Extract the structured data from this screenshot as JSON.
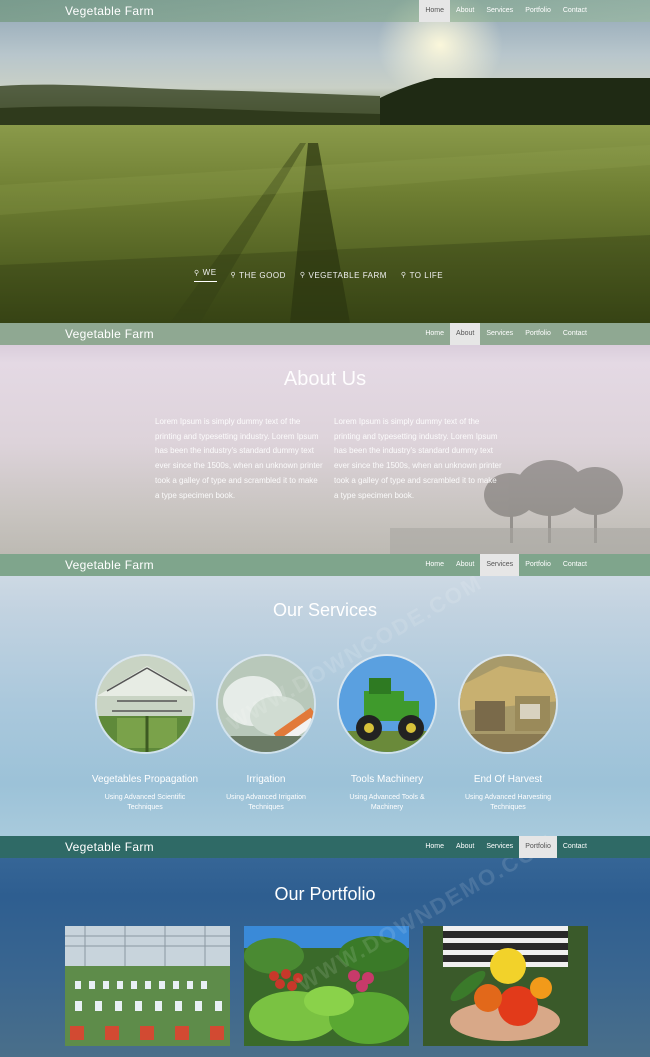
{
  "brand": "Vegetable Farm",
  "nav_items": [
    "Home",
    "About",
    "Services",
    "Portfolio",
    "Contact"
  ],
  "hero": {
    "tabs": [
      "WE",
      "THE GOOD",
      "VEGETABLE FARM",
      "TO LIFE"
    ],
    "active_tab": "WE"
  },
  "about": {
    "title": "About Us",
    "col1": "Lorem Ipsum is simply dummy text of the printing and typesetting industry. Lorem Ipsum has been the industry's standard dummy text ever since the 1500s, when an unknown printer took a galley of type and scrambled it to make a type specimen book.",
    "col2": "Lorem Ipsum is simply dummy text of the printing and typesetting industry. Lorem Ipsum has been the industry's standard dummy text ever since the 1500s, when an unknown printer took a galley of type and scrambled it to make a type specimen book."
  },
  "services": {
    "title": "Our Services",
    "items": [
      {
        "name": "Vegetables Propagation",
        "desc": "Using Advanced Scientific Techniques",
        "icon": "greenhouse-image"
      },
      {
        "name": "Irrigation",
        "desc": "Using Advanced Irrigation Techniques",
        "icon": "irrigation-image"
      },
      {
        "name": "Tools Machinery",
        "desc": "Using Advanced Tools & Machinery",
        "icon": "tractor-image"
      },
      {
        "name": "End Of Harvest",
        "desc": "Using Advanced Harvesting Techniques",
        "icon": "harvest-image"
      }
    ]
  },
  "portfolio": {
    "title": "Our Portfolio"
  },
  "colors": {
    "active_nav_bg": "#e6e6e6",
    "nav_about_bg": "#8fa892",
    "nav_services_bg": "#7fa58c",
    "nav_portfolio_bg": "#2f6a66"
  }
}
